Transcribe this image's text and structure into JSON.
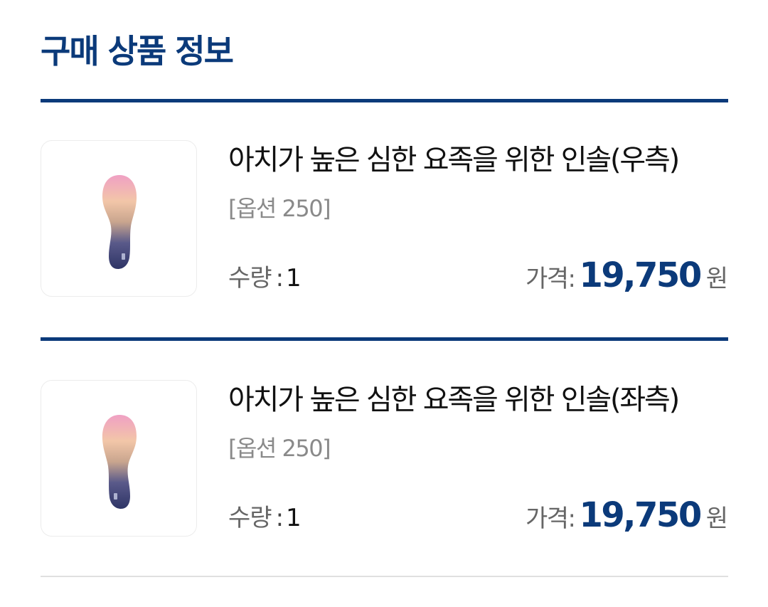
{
  "section": {
    "title": "구매 상품 정보"
  },
  "items": [
    {
      "name": "아치가 높은 심한 요족을 위한 인솔(우측)",
      "option": "[옵션 250]",
      "quantity_label": "수량",
      "quantity_sep": ":",
      "quantity_value": "1",
      "price_label": "가격:",
      "price_value": "19,750",
      "price_unit": "원",
      "thumbnail_icon": "insole-image"
    },
    {
      "name": "아치가 높은 심한 요족을 위한 인솔(좌측)",
      "option": "[옵션 250]",
      "quantity_label": "수량",
      "quantity_sep": ":",
      "quantity_value": "1",
      "price_label": "가격:",
      "price_value": "19,750",
      "price_unit": "원",
      "thumbnail_icon": "insole-image"
    }
  ],
  "colors": {
    "accent": "#0b3a7a",
    "muted_text": "#8a8a8a",
    "divider": "#e0e0e0"
  }
}
